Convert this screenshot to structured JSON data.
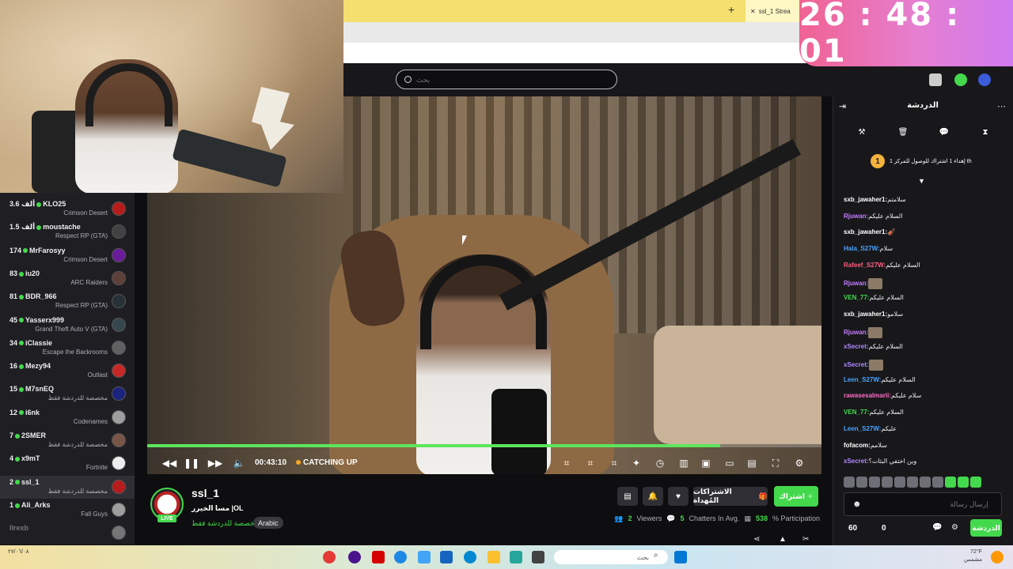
{
  "timer": {
    "text": "26 : 48 : 01"
  },
  "browser": {
    "tab_title": "ssl_1 Strea"
  },
  "topnav": {
    "search_placeholder": "بحث"
  },
  "sidebar": {
    "channels": [
      {
        "count": "3.6 ألف",
        "name": "KLO25",
        "game": "Crimson Desert"
      },
      {
        "count": "1.5 ألف",
        "name": "moustache",
        "game": "Respect RP (GTA)"
      },
      {
        "count": "174",
        "name": "MrFarosyy",
        "game": "Crimson Desert"
      },
      {
        "count": "83",
        "name": "iu20",
        "game": "ARC Raiders"
      },
      {
        "count": "81",
        "name": "BDR_966",
        "game": "Respect RP (GTA)"
      },
      {
        "count": "45",
        "name": "Yasserx999",
        "game": "Grand Theft Auto V (GTA)"
      },
      {
        "count": "34",
        "name": "iClassie",
        "game": "Escape the Backrooms"
      },
      {
        "count": "16",
        "name": "Mezy94",
        "game": "Outlast"
      },
      {
        "count": "15",
        "name": "M7snEQ",
        "game": "مخصصة للدردشة فقط"
      },
      {
        "count": "12",
        "name": "i6nk",
        "game": "Codenames"
      },
      {
        "count": "7",
        "name": "2SMER",
        "game": "مخصصة للدردشة فقط"
      },
      {
        "count": "4",
        "name": "x9mT",
        "game": "Fortnite"
      },
      {
        "count": "2",
        "name": "ssl_1",
        "game": "مخصصة للدردشة فقط"
      },
      {
        "count": "1",
        "name": "Ali_Arks",
        "game": "Fall Guys"
      },
      {
        "count": "",
        "name": "llrexb",
        "game": ""
      }
    ]
  },
  "player": {
    "time": "00:43:10",
    "status": "CATCHING UP",
    "progress_fraction": 0.85
  },
  "stream": {
    "streamer": "ssl_1",
    "live_label": "LIVE",
    "title": "مسا الخيرر |OL",
    "category": "مخصصة للدردشة فقط",
    "language": "Arabic",
    "gift_label": "الاشتراكات المُهداة",
    "subscribe_label": "اشتراك",
    "viewers_value": "2",
    "viewers_label": "Viewers",
    "chatters_value": "5",
    "chatters_label": "Chatters In Avg.",
    "participation_value": "538",
    "participation_label": "% Participation"
  },
  "chat": {
    "title": "الدردشة",
    "goal_rank": "1",
    "goal_text": "إهداء 1 اشتراك للوصول للمركز 1 th",
    "messages": [
      {
        "user": "sxb_jawaher1:",
        "text": "سلامتم",
        "color": "#ffffff"
      },
      {
        "user": "Rjuwan:",
        "text": "السلام عليكم",
        "color": "#c77dff"
      },
      {
        "user": "sxb_jawaher1:",
        "text": "🎻",
        "color": "#ffffff"
      },
      {
        "user": "Hala_S27W:",
        "text": "سلام",
        "color": "#4aa3ff"
      },
      {
        "user": "Rafeef_S27W:",
        "text": "السلام عليكم",
        "color": "#ff5e7e"
      },
      {
        "user": "Rjuwan:",
        "text": "",
        "color": "#c77dff",
        "emote": true
      },
      {
        "user": "VEN_77:",
        "text": "السلام عليكم",
        "color": "#44d94d"
      },
      {
        "user": "sxb_jawaher1:",
        "text": "سلامو",
        "color": "#ffffff"
      },
      {
        "user": "Rjuwan:",
        "text": "",
        "color": "#c77dff",
        "emote": true
      },
      {
        "user": "xSecret:",
        "text": "السلام عليكم",
        "color": "#b388ff"
      },
      {
        "user": "xSecret:",
        "text": "",
        "color": "#b388ff",
        "emote": true
      },
      {
        "user": "Leen_S27W:",
        "text": "السلام عليكم",
        "color": "#4aa3ff"
      },
      {
        "user": "rawasesalmarii:",
        "text": "سلام عليكم",
        "color": "#ff6ec7"
      },
      {
        "user": "VEN_77:",
        "text": "السلام عليكم",
        "color": "#44d94d"
      },
      {
        "user": "Leen_S27W:",
        "text": "عليكم",
        "color": "#4aa3ff"
      },
      {
        "user": "fofacom:",
        "text": "سلامم",
        "color": "#ffffff"
      },
      {
        "user": "xSecret:",
        "text": "وين اختفي البثات؟",
        "color": "#b388ff"
      }
    ],
    "input_placeholder": "إرسال رسالة",
    "points": "60",
    "zero": "0",
    "send_label": "الدردشة"
  },
  "taskbar": {
    "search_placeholder": "بحث",
    "date": "٢٧/٠٦/٠٨",
    "weather_temp": "72°F",
    "weather_desc": "مشمس"
  }
}
